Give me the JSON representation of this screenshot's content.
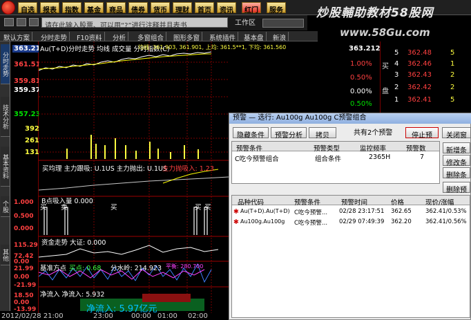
{
  "watermark": "炒股輔助教材58股网",
  "watermark_url": "www.58Gu.com",
  "menu": [
    "自选",
    "报表",
    "指数",
    "基金",
    "商品",
    "债券",
    "货币",
    "理财",
    "首页",
    "资讯",
    "红门",
    "服务"
  ],
  "search": {
    "text": "请在此输入股票、可以用“?”进行注释并且表书"
  },
  "work_area_label": "工作区",
  "tabs": [
    "默认方案",
    "分时走势",
    "F10资料",
    "分析",
    "多窗组合",
    "图形多窗",
    "系统插件",
    "基本盘",
    "新浪"
  ],
  "vtabs": [
    "分时走势",
    "技术分析",
    "基本资料",
    "个股",
    "其他"
  ],
  "chart": {
    "title": "Au(T+D)分时走势 均线 成交量 分时指数(C)",
    "ma_line": "均线: 361.903, 361.901, 上均: 361.5**1, 下均: 361.560",
    "price_labels": [
      "363.212",
      "361.51",
      "359.81",
      "359.37",
      "357.23",
      "392",
      "261",
      "131"
    ],
    "pct_labels": [
      "1.00%",
      "0.50%",
      "0.00%",
      "0.50%",
      "1.00%"
    ],
    "pct_top": "363.212",
    "main_force": "买均理 主力跟吸: U.1US 主力抛出: U.1US",
    "main_force_right": "主力抛吸入: 1.23",
    "sub1_title": "B点吸入量 0.000",
    "sub1_labels": [
      "1.000",
      "0.500",
      "0.000"
    ],
    "sub1_marks": [
      "买",
      "卖",
      "买"
    ],
    "sub1_marks_right": [
      "买",
      "买"
    ],
    "sub2_title": "资金走势 大证: 0.000",
    "sub2_labels": [
      "115.29",
      "72.42",
      "0.00"
    ],
    "sub3_title": "基准方点",
    "sub3_values": [
      "买点: 0.68",
      "分水岭: 214.923",
      "平衡: 280.700"
    ],
    "sub3_labels": [
      "21.99",
      "0.00",
      "-21.99"
    ],
    "net_title": "净流入 净流入: 5.932",
    "net_value": "净流入: 5.97亿元",
    "net_labels": [
      "18.50",
      "0.00",
      "-13.99"
    ]
  },
  "time_labels": [
    "2012/02/28 21:00",
    "23:00",
    "00:00",
    "01:00",
    "02:00"
  ],
  "orderbook": {
    "top_prices": [
      "363.212",
      "362.60"
    ],
    "side_labels": [
      "买",
      "盘"
    ],
    "levels": [
      {
        "n": "5",
        "p": "362.48",
        "v": "5"
      },
      {
        "n": "4",
        "p": "362.46",
        "v": "1"
      },
      {
        "n": "3",
        "p": "362.43",
        "v": "2"
      },
      {
        "n": "2",
        "p": "362.42",
        "v": "2"
      },
      {
        "n": "1",
        "p": "362.41",
        "v": "5"
      }
    ]
  },
  "dialog": {
    "title": "预警 — 选行: Au100g Au100g C预警组合",
    "btn_hide": "隐藏条件",
    "btn_analyze": "预警分析",
    "btn_copy": "拷贝",
    "count_text": "共有2个预警",
    "btn_stop": "停止预警",
    "btn_close": "关闭窗口",
    "side_buttons": [
      "新增条件",
      "修改条件",
      "删除条件",
      "删除预警"
    ],
    "cond_headers": [
      "预警条件",
      "预警类型",
      "监控频率",
      "预警数"
    ],
    "cond_rows": [
      {
        "name": "C吃今预警组合",
        "type": "组合条件",
        "freq": "2365H",
        "count": "7"
      }
    ],
    "list_headers": [
      "品种代码",
      "预警条件",
      "预警时间",
      "价格",
      "现价/涨幅"
    ],
    "list_rows": [
      {
        "code": "Au(T+D).Au(T+D)",
        "cond": "C吃今预警...",
        "time": "02/28 23:17:51",
        "price": "362.65",
        "now": "362.41/0.53%"
      },
      {
        "code": "Au100g.Au100g",
        "cond": "C吃今预警...",
        "time": "02/29 07:49:39",
        "price": "362.20",
        "now": "362.41/0.56%"
      }
    ]
  }
}
